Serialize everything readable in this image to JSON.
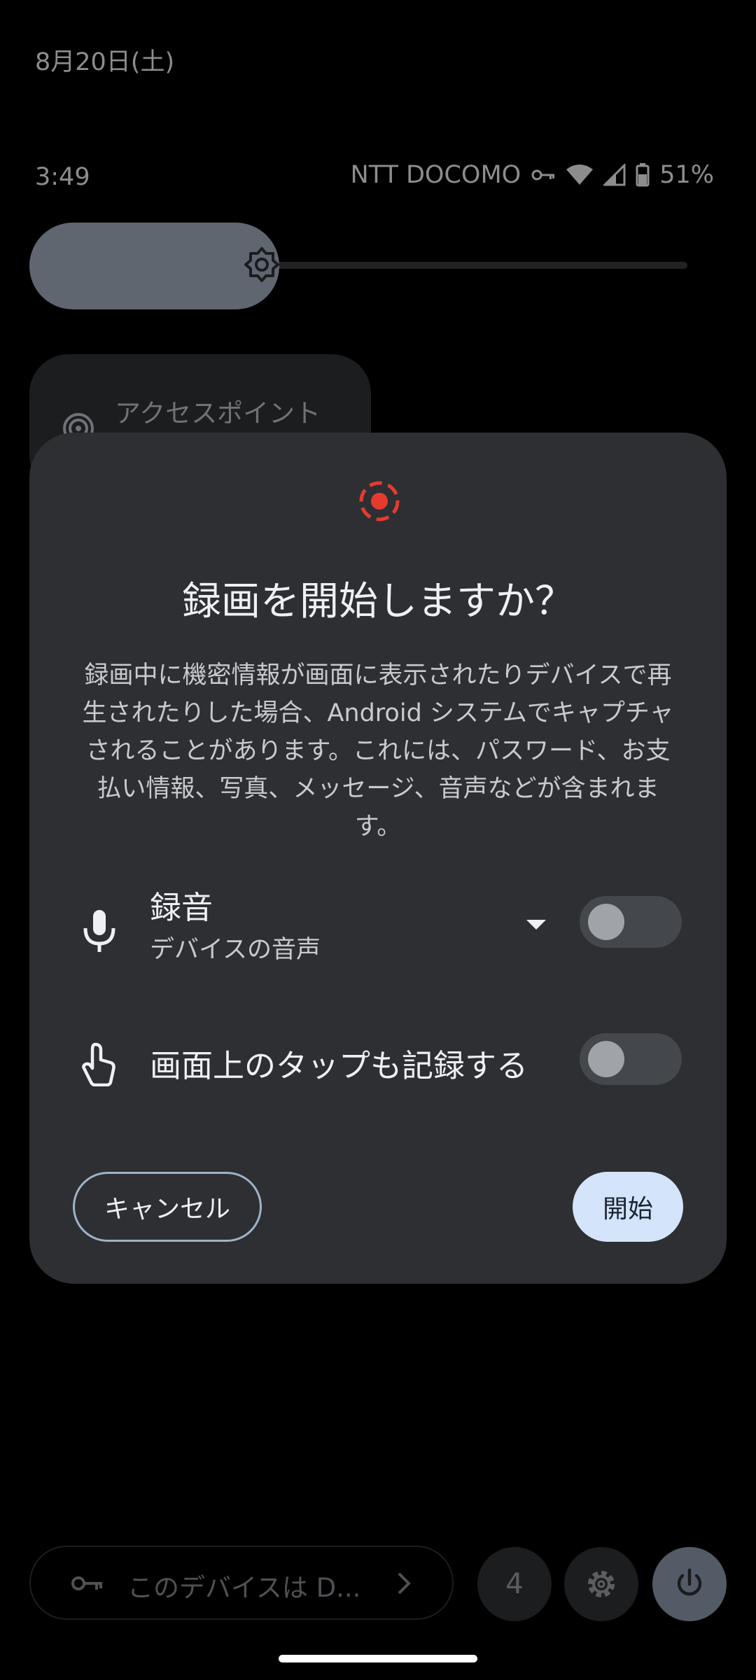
{
  "status_bar": {
    "date": "8月20日(土)",
    "time": "3:49",
    "carrier": "NTT DOCOMO",
    "battery": "51%"
  },
  "quick_settings": {
    "hotspot_label": "アクセスポイント",
    "brightness_level": 0.38
  },
  "dialog": {
    "title": "録画を開始しますか？",
    "body": "録画中に機密情報が画面に表示されたりデバイスで再生されたりした場合、Android システムでキャプチャされることがあります。これには、パスワード、お支払い情報、写真、メッセージ、音声などが含まれます。",
    "audio_title": "録音",
    "audio_source": "デバイスの音声",
    "audio_enabled": false,
    "taps_label": "画面上のタップも記録する",
    "taps_enabled": false,
    "cancel_label": "キャンセル",
    "start_label": "開始",
    "accent_color": "#e53b2f"
  },
  "footer": {
    "device_text": "このデバイスは D...",
    "user_count": "4"
  },
  "icons": {
    "record": "screen-record-icon",
    "mic": "microphone-icon",
    "tap": "touch-icon",
    "brightness": "brightness-icon",
    "hotspot": "hotspot-icon",
    "vpn_key": "vpn-key-icon",
    "settings": "gear-icon",
    "power": "power-icon"
  }
}
